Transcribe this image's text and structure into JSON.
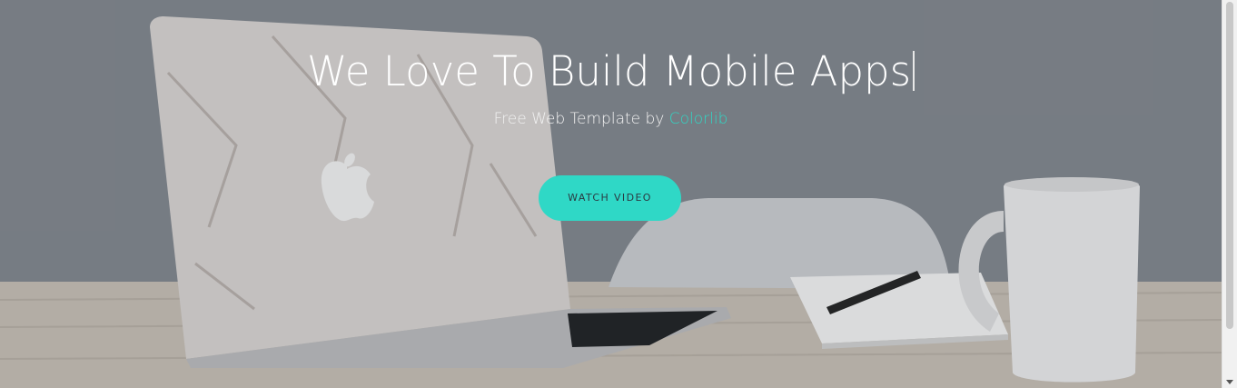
{
  "hero": {
    "title": "We Love To Build Mobile Apps",
    "subtitle_prefix": "Free Web Template by ",
    "subtitle_link": "Colorlib",
    "cta_label": "WATCH VIDEO"
  },
  "colors": {
    "accent": "#2fd8c6",
    "text": "#ffffff"
  },
  "icons": {
    "scrollbar_down": "chevron-down-icon"
  }
}
